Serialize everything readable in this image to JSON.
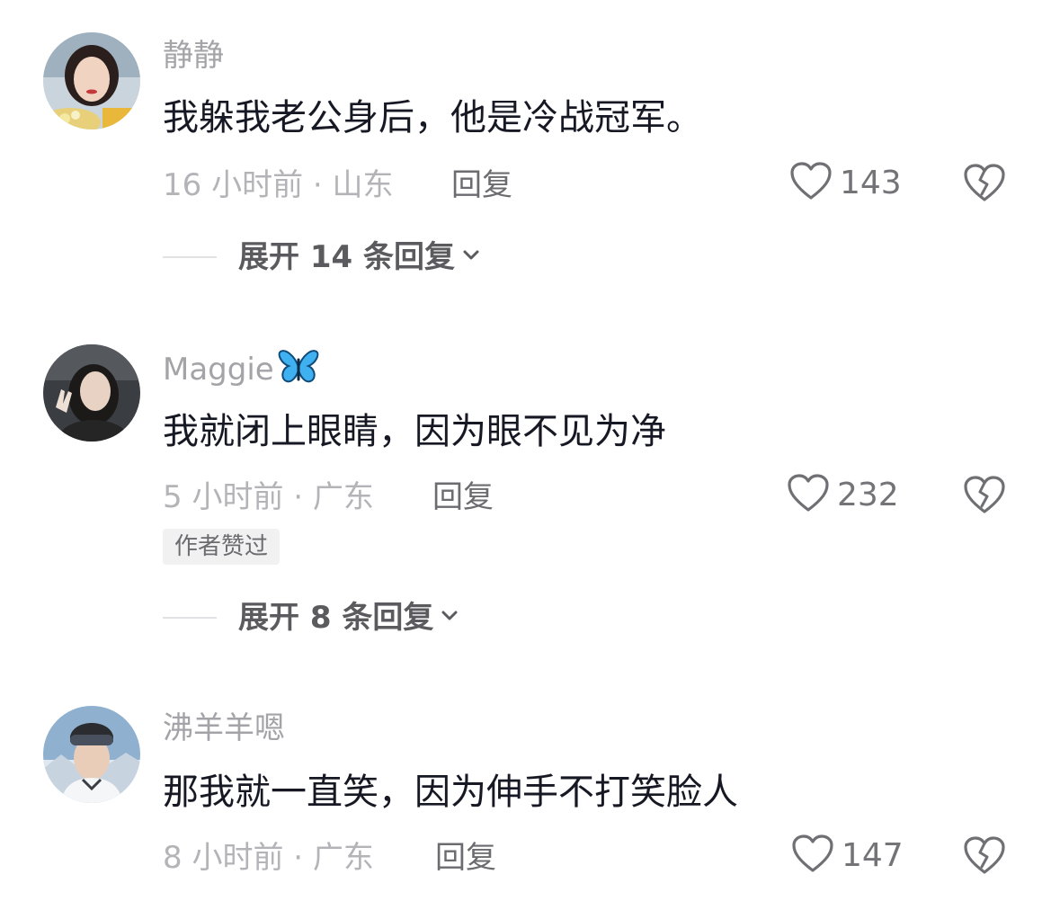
{
  "comments": [
    {
      "username": "静静",
      "text": "我躲我老公身后，他是冷战冠军。",
      "meta": "16 小时前 · 山东",
      "reply_label": "回复",
      "likes": "143",
      "expand_label": "展开 14 条回复"
    },
    {
      "username": "Maggie",
      "username_emoji": "butterfly",
      "text": "我就闭上眼睛，因为眼不见为净",
      "meta": "5 小时前 · 广东",
      "reply_label": "回复",
      "likes": "232",
      "badge": "作者赞过",
      "expand_label": "展开 8 条回复"
    },
    {
      "username": "沸羊羊嗯",
      "text": "那我就一直笑，因为伸手不打笑脸人",
      "meta": "8 小时前 · 广东",
      "reply_label": "回复",
      "likes": "147"
    }
  ],
  "icons": {
    "like": "heart-outline-icon",
    "dislike": "broken-heart-icon",
    "expand": "chevron-down-icon"
  },
  "colors": {
    "text_primary": "#161823",
    "text_secondary": "#a3a3a8",
    "badge_bg": "#f1f1f2"
  }
}
